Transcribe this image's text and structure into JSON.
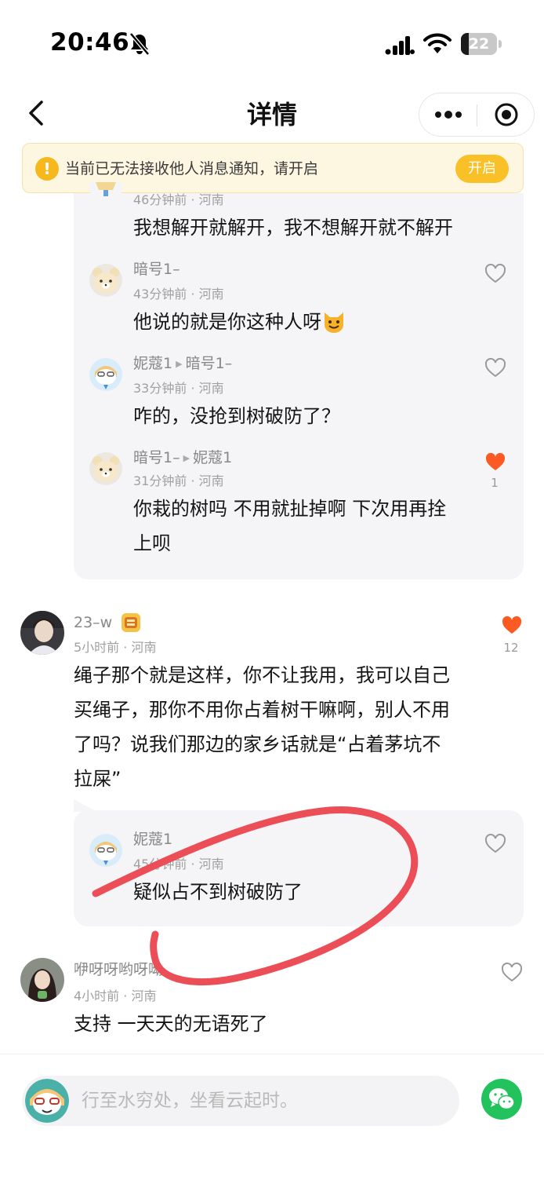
{
  "status_bar": {
    "time": "20:46",
    "battery": "22",
    "battery_level": 0.22
  },
  "nav": {
    "title": "详情"
  },
  "notice": {
    "text": "当前已无法接收他人消息通知，请开启",
    "button": "开启"
  },
  "thread1": {
    "replies": [
      {
        "meta": "46分钟前 · 河南",
        "text": "我想解开就解开，我不想解开就不解开"
      },
      {
        "author": "暗号1–",
        "meta": "43分钟前 · 河南",
        "text": "他说的就是你这种人呀"
      },
      {
        "author": "妮蔻1",
        "reply_to": "暗号1–",
        "meta": "33分钟前 · 河南",
        "text": "咋的，没抢到树破防了？"
      },
      {
        "author": "暗号1–",
        "reply_to": "妮蔻1",
        "meta": "31分钟前 · 河南",
        "likes": "1",
        "text_line1": "你栽的树吗 不用就扯掉啊 下次用再拴",
        "text_line2": "上呗"
      }
    ]
  },
  "comment1": {
    "author": "23–w",
    "meta": "5小时前 · 河南",
    "likes": "12",
    "lines": [
      "绳子那个就是这样，你不让我用，我可以自己",
      "买绳子，那你不用你占着树干嘛啊，别人不用",
      "了吗？说我们那边的家乡话就是“占着茅坑不",
      "拉屎”"
    ],
    "reply": {
      "author": "妮蔻1",
      "meta": "45分钟前 · 河南",
      "text": "疑似占不到树破防了"
    }
  },
  "comment2": {
    "author": "咿呀呀哟呀呦",
    "meta": "4小时前 · 河南",
    "text": "支持 一天天的无语死了"
  },
  "input": {
    "placeholder": "行至水穷处，坐看云起时。"
  },
  "colors": {
    "like_active": "#fb5a23",
    "accent_yellow": "#fac028",
    "wechat_green": "#22c35d",
    "scribble": "#ec4e57"
  },
  "icons": [
    "bell-off-icon",
    "signal-icon",
    "wifi-icon",
    "battery-icon",
    "back-icon",
    "more-icon",
    "close-target-icon",
    "warning-icon",
    "heart-icon",
    "heart-filled-icon",
    "wechat-icon"
  ]
}
